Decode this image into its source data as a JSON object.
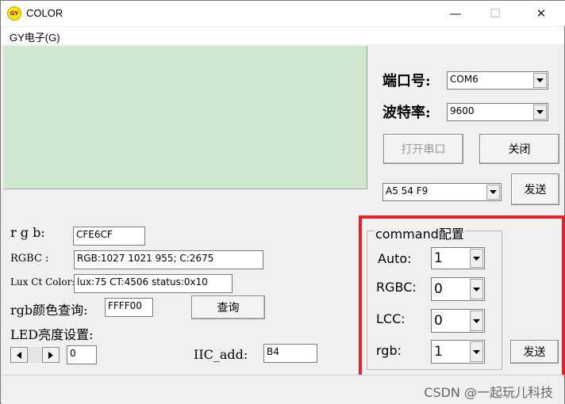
{
  "window": {
    "title": "COLOR",
    "icon_text": "GY",
    "controls": {
      "minimize": "—",
      "maximize": "☐",
      "close": "✕"
    }
  },
  "menu": {
    "items": [
      {
        "label": "GY电子(G)"
      }
    ]
  },
  "colors": {
    "preview": "#cfe6cf",
    "highlight_border": "#e8202a"
  },
  "left": {
    "rgb_label": "r g b:",
    "rgb_value": "CFE6CF",
    "rgbc_label": "RGBC :",
    "rgbc_value": "RGB:1027  1021 955;   C:2675",
    "lux_label": "Lux Ct Color:",
    "lux_value": "lux:75  CT:4506  status:0x10",
    "query_label": "rgb颜色查询:",
    "query_value": "FFFF00",
    "query_button": "查询",
    "led_label": "LED亮度设置:",
    "led_value": "0",
    "iic_label": "IIC_add:",
    "iic_value": "B4"
  },
  "right": {
    "port_label": "端口号:",
    "port_value": "COM6",
    "baud_label": "波特率:",
    "baud_value": "9600",
    "open_button": "打开串口",
    "close_button": "关闭",
    "command_value": "A5 54 F9",
    "send_button": "发送"
  },
  "command_group": {
    "title": "command配置",
    "auto_label": "Auto:",
    "auto_value": "1",
    "rgbc_label": "RGBC:",
    "rgbc_value": "0",
    "lcc_label": "LCC:",
    "lcc_value": "0",
    "rgb_label": "rgb:",
    "rgb_value": "1",
    "send_button": "发送"
  },
  "watermark": "CSDN @一起玩儿科技"
}
